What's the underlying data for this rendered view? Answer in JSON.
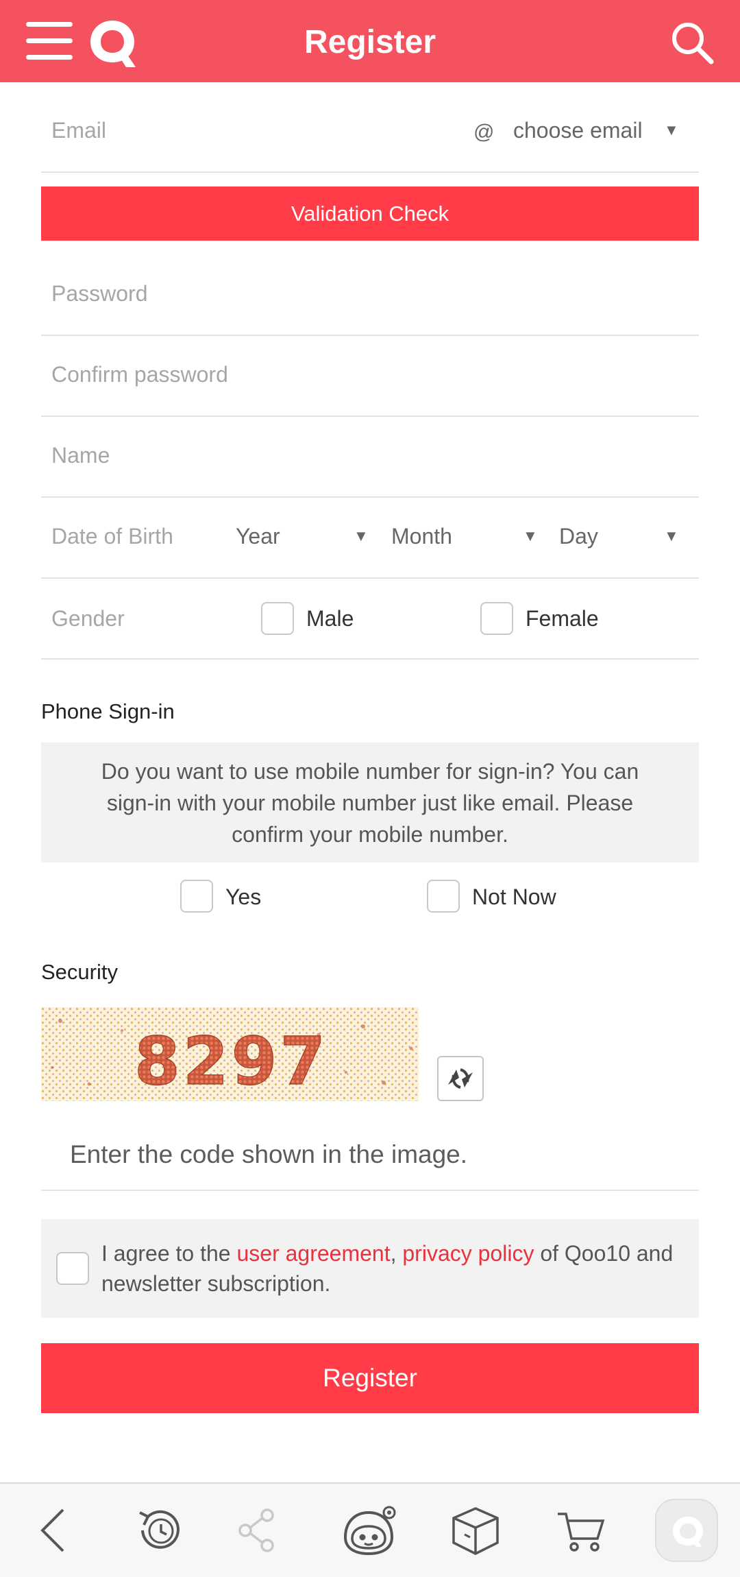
{
  "header": {
    "title": "Register",
    "menu_icon": "hamburger-menu-icon",
    "logo_letter": "Q",
    "search_icon": "search-icon"
  },
  "form": {
    "email": {
      "placeholder": "Email",
      "at": "@",
      "domain_select": "choose email"
    },
    "validation_button": "Validation Check",
    "password": {
      "placeholder": "Password"
    },
    "confirm_password": {
      "placeholder": "Confirm password"
    },
    "name": {
      "placeholder": "Name"
    },
    "dob": {
      "label": "Date of Birth",
      "year": "Year",
      "month": "Month",
      "day": "Day"
    },
    "gender": {
      "label": "Gender",
      "male": "Male",
      "female": "Female"
    }
  },
  "phone": {
    "title": "Phone Sign-in",
    "info": "Do you want to use mobile number for sign-in?  You can sign-in with your mobile number just like email. Please confirm your mobile number.",
    "yes": "Yes",
    "not_now": "Not Now"
  },
  "security": {
    "title": "Security",
    "captcha_code": "8297",
    "code_placeholder": "Enter the code shown in the image."
  },
  "agreement": {
    "prefix": "I agree to the ",
    "user_agreement": "user agreement",
    "comma": ",",
    "privacy_policy": "privacy policy",
    "suffix": " of Qoo10 and newsletter subscription."
  },
  "register_button": "Register",
  "bottom_nav": [
    "back-icon",
    "history-icon",
    "share-icon",
    "qchat-mascot-icon",
    "package-box-icon",
    "cart-icon",
    "qoo10-home-icon"
  ],
  "colors": {
    "brand": "#f5525f",
    "button": "#ff3c48",
    "link": "#e8323e"
  }
}
